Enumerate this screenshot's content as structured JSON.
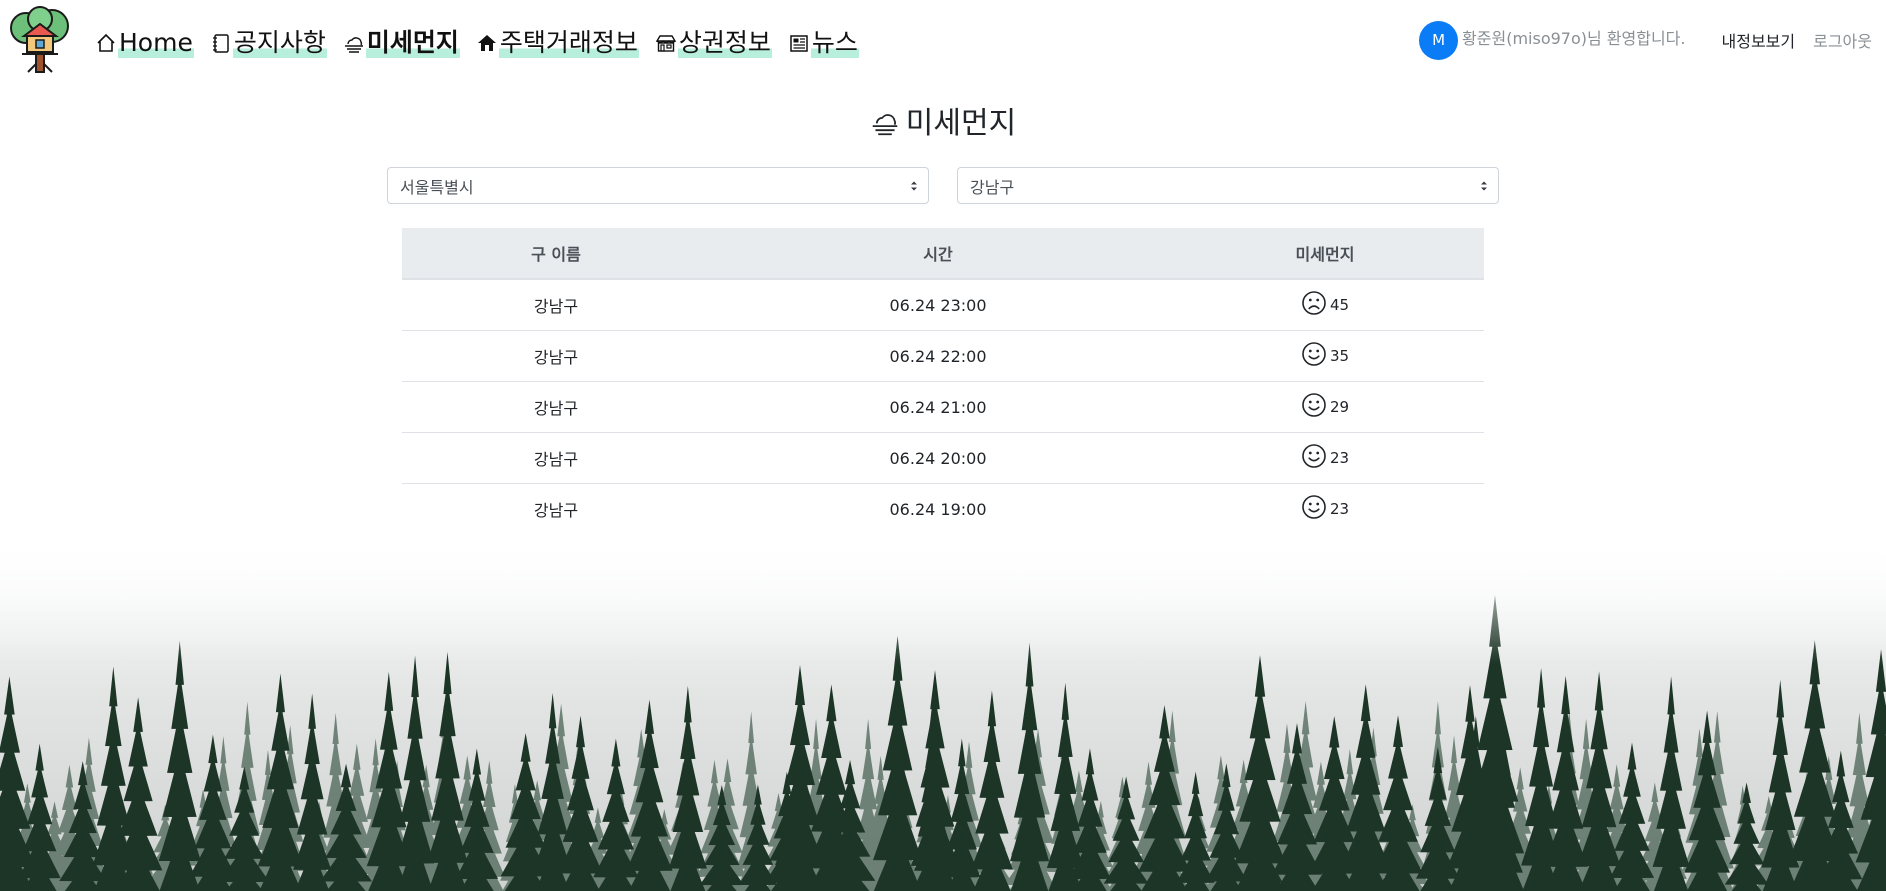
{
  "header": {
    "nav": [
      {
        "label": "Home",
        "icon": "home-icon",
        "active": false
      },
      {
        "label": "공지사항",
        "icon": "notebook-icon",
        "active": false
      },
      {
        "label": "미세먼지",
        "icon": "cloud-haze-icon",
        "active": true
      },
      {
        "label": "주택거래정보",
        "icon": "house-icon",
        "active": false
      },
      {
        "label": "상권정보",
        "icon": "shop-icon",
        "active": false
      },
      {
        "label": "뉴스",
        "icon": "newspaper-icon",
        "active": false
      }
    ],
    "user": {
      "avatar_letter": "M",
      "name": "황준원(miso97o)",
      "greeting_suffix": "님 환영합니다."
    },
    "my_info_label": "내정보보기",
    "logout_label": "로그아웃"
  },
  "page": {
    "title": "미세먼지",
    "title_icon": "cloud-haze-icon"
  },
  "filters": {
    "city": "서울특별시",
    "district": "강남구"
  },
  "table": {
    "headers": [
      "구 이름",
      "시간",
      "미세먼지"
    ],
    "rows": [
      {
        "name": "강남구",
        "time": "06.24 23:00",
        "face": "frown",
        "value": "45"
      },
      {
        "name": "강남구",
        "time": "06.24 22:00",
        "face": "smile",
        "value": "35"
      },
      {
        "name": "강남구",
        "time": "06.24 21:00",
        "face": "smile",
        "value": "29"
      },
      {
        "name": "강남구",
        "time": "06.24 20:00",
        "face": "smile",
        "value": "23"
      },
      {
        "name": "강남구",
        "time": "06.24 19:00",
        "face": "smile",
        "value": "23"
      }
    ]
  },
  "colors": {
    "nav_highlight": "#b8eedc",
    "avatar": "#0a7cf5",
    "table_header_bg": "#e9ecef",
    "forest": "#1f3a2a"
  }
}
